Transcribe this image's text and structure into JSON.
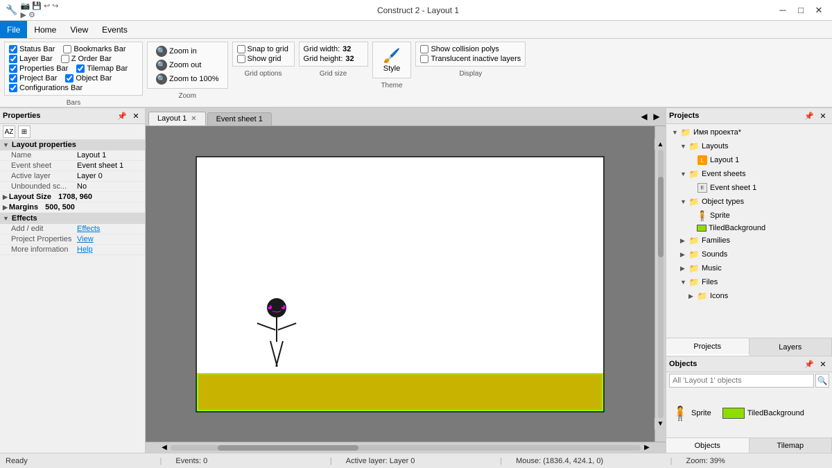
{
  "window": {
    "title": "Construct 2 - Layout 1"
  },
  "titlebar": {
    "minimize_label": "─",
    "maximize_label": "□",
    "close_label": "✕"
  },
  "menubar": {
    "items": [
      {
        "id": "file",
        "label": "File",
        "active": true
      },
      {
        "id": "home",
        "label": "Home"
      },
      {
        "id": "view",
        "label": "View"
      },
      {
        "id": "events",
        "label": "Events"
      }
    ]
  },
  "ribbon": {
    "bars_group": {
      "label": "Bars",
      "checkboxes": [
        {
          "id": "status-bar",
          "label": "Status Bar",
          "checked": true
        },
        {
          "id": "bookmarks-bar",
          "label": "Bookmarks Bar",
          "checked": false
        },
        {
          "id": "layer-bar",
          "label": "Layer Bar",
          "checked": true
        },
        {
          "id": "z-order-bar",
          "label": "Z Order Bar",
          "checked": false
        },
        {
          "id": "tilemap-bar",
          "label": "Tilemap Bar",
          "checked": true
        },
        {
          "id": "properties-bar",
          "label": "Properties Bar",
          "checked": true
        },
        {
          "id": "object-bar",
          "label": "Object Bar",
          "checked": true
        },
        {
          "id": "configurations-bar",
          "label": "Configurations Bar",
          "checked": true
        },
        {
          "id": "project-bar",
          "label": "Project Bar",
          "checked": true
        }
      ]
    },
    "zoom_group": {
      "label": "Zoom",
      "zoom_in": "Zoom in",
      "zoom_out": "Zoom out",
      "zoom_100": "Zoom to 100%"
    },
    "grid_group": {
      "label": "Grid options",
      "snap_to_grid": "Snap to grid",
      "show_grid": "Show grid"
    },
    "grid_size_group": {
      "label": "Grid size",
      "width_label": "Grid width:",
      "width_value": "32",
      "height_label": "Grid height:",
      "height_value": "32"
    },
    "theme_group": {
      "label": "Theme",
      "style_label": "Style"
    },
    "display_group": {
      "label": "Display",
      "show_collision": "Show collision polys",
      "translucent": "Translucent inactive layers"
    }
  },
  "tabs": [
    {
      "id": "layout1",
      "label": "Layout 1",
      "active": true,
      "closable": true
    },
    {
      "id": "events1",
      "label": "Event sheet 1",
      "active": false,
      "closable": false
    }
  ],
  "properties": {
    "title": "Properties",
    "section": "Layout properties",
    "rows": [
      {
        "label": "Name",
        "value": "Layout 1"
      },
      {
        "label": "Event sheet",
        "value": "Event sheet 1"
      },
      {
        "label": "Active layer",
        "value": "Layer 0"
      },
      {
        "label": "Unbounded sc...",
        "value": "No"
      }
    ],
    "layout_size": {
      "label": "Layout Size",
      "value": "1708, 960"
    },
    "margins": {
      "label": "Margins",
      "value": "500, 500"
    },
    "effects": {
      "title": "Effects",
      "add_edit": {
        "label": "Add / edit",
        "link": "Effects"
      },
      "project_props": {
        "label": "Project Properties",
        "link": "View"
      },
      "more_info": {
        "label": "More information",
        "link": "Help"
      }
    }
  },
  "project_tree": {
    "title": "Projects",
    "root": "Имя проекта*",
    "items": [
      {
        "id": "layouts",
        "label": "Layouts",
        "type": "folder",
        "indent": 2,
        "expanded": true
      },
      {
        "id": "layout1",
        "label": "Layout 1",
        "type": "layout",
        "indent": 3
      },
      {
        "id": "event-sheets",
        "label": "Event sheets",
        "type": "folder",
        "indent": 2,
        "expanded": true
      },
      {
        "id": "event-sheet1",
        "label": "Event sheet 1",
        "type": "event",
        "indent": 3
      },
      {
        "id": "object-types",
        "label": "Object types",
        "type": "folder",
        "indent": 2,
        "expanded": true
      },
      {
        "id": "sprite",
        "label": "Sprite",
        "type": "sprite",
        "indent": 3
      },
      {
        "id": "tiled-bg",
        "label": "TiledBackground",
        "type": "tiled",
        "indent": 3
      },
      {
        "id": "families",
        "label": "Families",
        "type": "folder",
        "indent": 2,
        "expanded": false
      },
      {
        "id": "sounds",
        "label": "Sounds",
        "type": "folder",
        "indent": 2,
        "expanded": false
      },
      {
        "id": "music",
        "label": "Music",
        "type": "folder",
        "indent": 2,
        "expanded": false
      },
      {
        "id": "files",
        "label": "Files",
        "type": "folder",
        "indent": 2,
        "expanded": true
      },
      {
        "id": "icons",
        "label": "Icons",
        "type": "folder",
        "indent": 3,
        "expanded": false
      }
    ]
  },
  "panel_tabs": [
    {
      "id": "projects",
      "label": "Projects",
      "active": true
    },
    {
      "id": "layers",
      "label": "Layers",
      "active": false
    }
  ],
  "objects_panel": {
    "title": "Objects",
    "search_placeholder": "All 'Layout 1' objects",
    "items": [
      {
        "id": "sprite",
        "label": "Sprite",
        "type": "sprite"
      },
      {
        "id": "tiled-bg",
        "label": "TiledBackground",
        "type": "tiled"
      }
    ]
  },
  "obj_panel_tabs": [
    {
      "id": "objects",
      "label": "Objects",
      "active": true
    },
    {
      "id": "tilemap",
      "label": "Tilemap",
      "active": false
    }
  ],
  "statusbar": {
    "ready": "Ready",
    "events": "Events: 0",
    "active_layer": "Active layer: Layer 0",
    "mouse": "Mouse: (1836.4, 424.1, 0)",
    "zoom": "Zoom: 39%"
  }
}
